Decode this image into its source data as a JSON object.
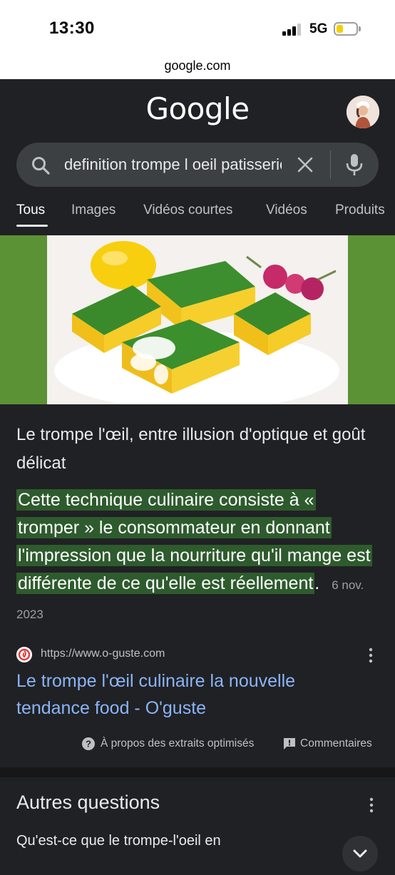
{
  "status_bar": {
    "time": "13:30",
    "network": "5G",
    "battery_level": 0.35,
    "battery_color": "#f5d000"
  },
  "browser": {
    "url": "google.com"
  },
  "header": {
    "logo_text": "Google",
    "avatar_icon": "profile-avatar"
  },
  "search": {
    "query": "definition trompe l oeil patisserie",
    "icons": [
      "search-icon",
      "clear-icon",
      "mic-icon"
    ]
  },
  "tabs": [
    {
      "label": "Tous",
      "active": true
    },
    {
      "label": "Images"
    },
    {
      "label": "Vidéos courtes"
    },
    {
      "label": "Vidéos"
    },
    {
      "label": "Produits"
    }
  ],
  "snippet": {
    "title": "Le trompe l'œil, entre illusion d'optique et goût délicat",
    "body": "Cette technique culinaire consiste à « tromper » le consommateur en donnant l'impression que la nourriture qu'il mange est différente de ce qu'elle est réellement",
    "body_suffix": ".",
    "date": "6 nov. 2023",
    "highlight_color": "#2e5b2d",
    "source_url": "https://www.o-guste.com",
    "link_title": "Le trompe l'œil culinaire la nouvelle tendance food - O'guste",
    "link_color": "#8ab4f8"
  },
  "footer": {
    "about_label": "À propos des extraits optimisés",
    "feedback_label": "Commentaires"
  },
  "related": {
    "title": "Autres questions",
    "first_question": "Qu'est-ce que le trompe-l'oeil en"
  }
}
